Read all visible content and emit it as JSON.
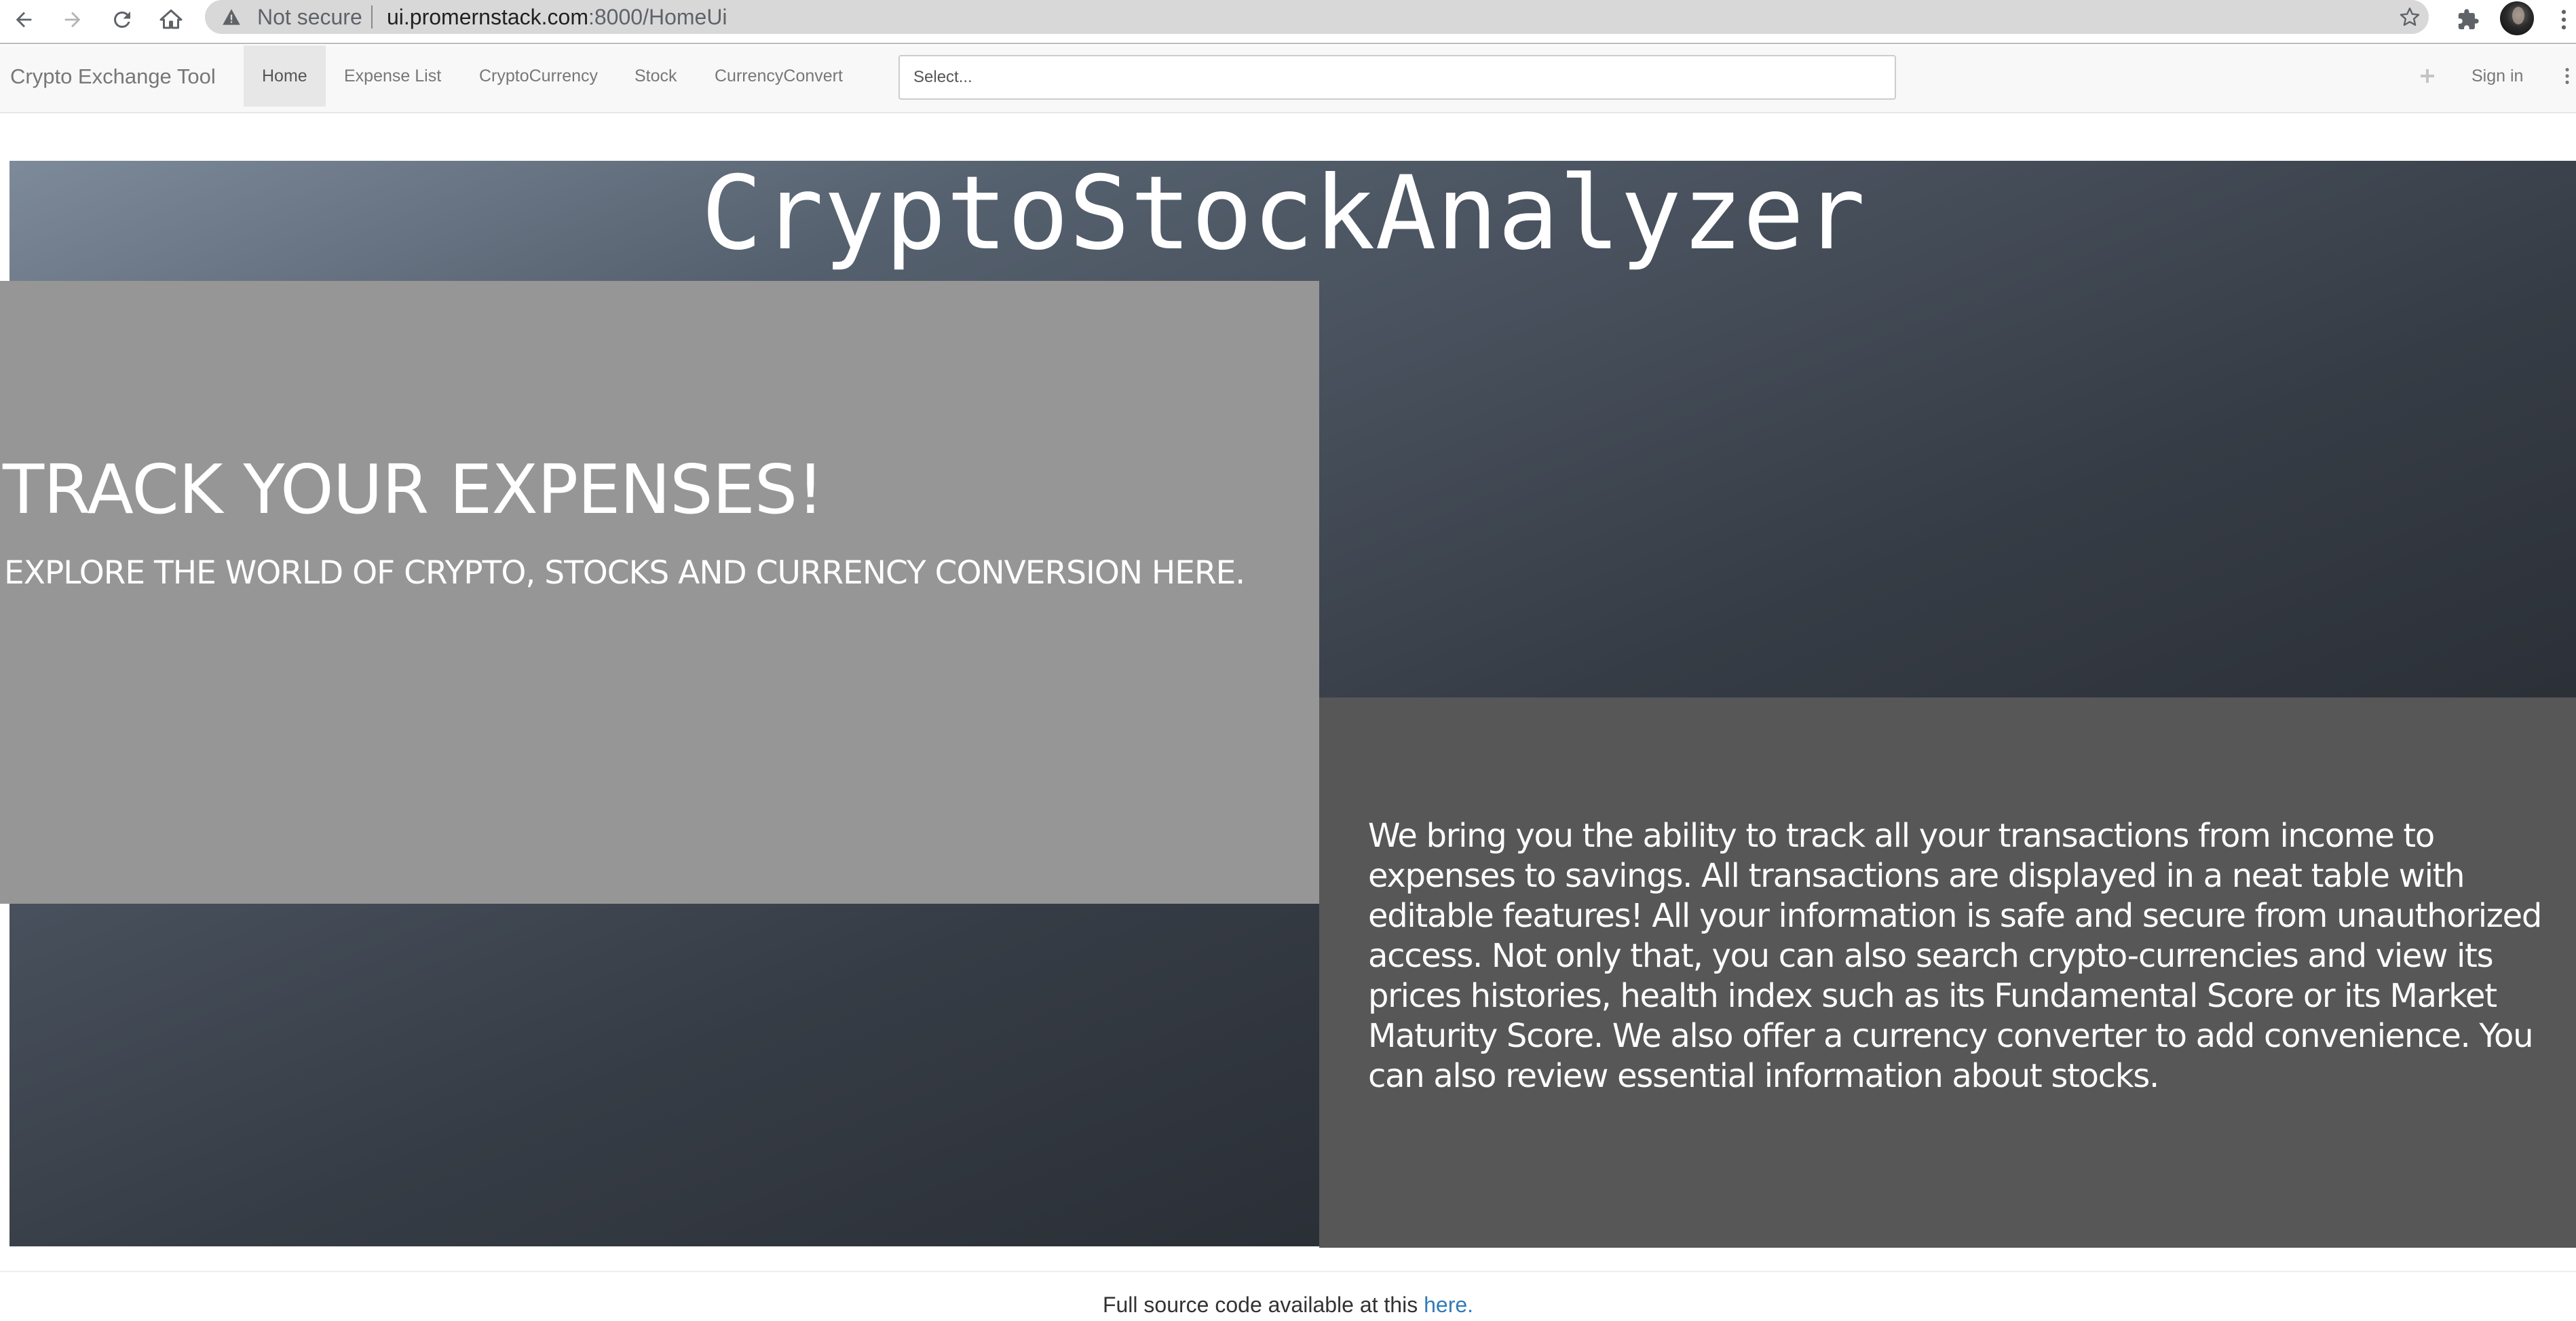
{
  "browser": {
    "security_label": "Not secure",
    "url_host": "ui.promernstack.com",
    "url_rest": ":8000/HomeUi",
    "icons": [
      "back-arrow-icon",
      "forward-arrow-icon",
      "reload-icon",
      "home-icon",
      "warning-icon",
      "star-icon",
      "puzzle-icon",
      "avatar",
      "kebab-menu-icon"
    ]
  },
  "navbar": {
    "brand": "Crypto Exchange Tool",
    "links": [
      {
        "label": "Home",
        "active": true
      },
      {
        "label": "Expense List",
        "active": false
      },
      {
        "label": "CryptoCurrency",
        "active": false
      },
      {
        "label": "Stock",
        "active": false
      },
      {
        "label": "CurrencyConvert",
        "active": false
      }
    ],
    "select_placeholder": "Select...",
    "sign_in": "Sign in"
  },
  "hero": {
    "title": "CryptoStockAnalyzer",
    "heading": "TRACK YOUR EXPENSES!",
    "subheading": "EXPLORE THE WORLD OF CRYPTO, STOCKS AND CURRENCY CONVERSION HERE.",
    "description": "We bring you the ability to track all your transactions from income to expenses to savings. All transactions are displayed in a neat table with editable features! All your information is safe and secure from unauthorized access. Not only that, you can also search crypto-currencies and view its prices histories, health index such as its Fundamental Score or its Market Maturity Score. We also offer a currency converter to add convenience. You can also review essential information about stocks."
  },
  "footer": {
    "text": "Full source code available at this ",
    "link": "here."
  },
  "colors": {
    "link": "#337ab7",
    "left_panel": "#969696",
    "right_panel": "#575757",
    "navbar_bg": "#f8f8f8",
    "active_tab_bg": "#e7e7e7"
  }
}
